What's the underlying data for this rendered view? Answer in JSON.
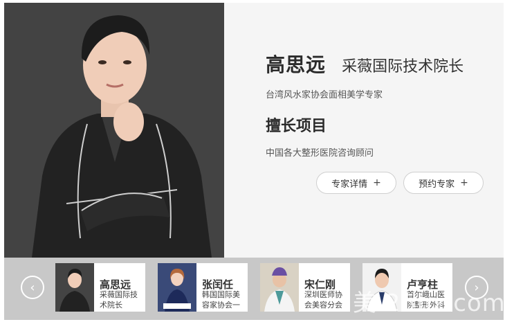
{
  "profile": {
    "name": "高思远",
    "title": "采薇国际技术院长",
    "subtitle": "台湾风水家协会面相美学专家",
    "section_heading": "擅长项目",
    "description": "中国各大整形医院咨询顾问"
  },
  "buttons": {
    "detail_label": "专家详情",
    "book_label": "预约专家",
    "plus": "+"
  },
  "carousel": {
    "prev_icon": "chevron-left-icon",
    "next_icon": "chevron-right-icon",
    "cards": [
      {
        "name": "高思远",
        "title": "采薇国际技术院长"
      },
      {
        "name": "张闰任",
        "title": "韩国国际美容家协会一"
      },
      {
        "name": "宋仁刚",
        "title": "深圳医师协会美容分会"
      },
      {
        "name": "卢亨柱",
        "title": "首尔峨山医院整形外科"
      }
    ]
  },
  "watermark": "美 25bz.com",
  "colors": {
    "strip_bg": "#c8c8c8",
    "hero_bg": "#f5f5f5",
    "text_dark": "#2b2b2b"
  }
}
